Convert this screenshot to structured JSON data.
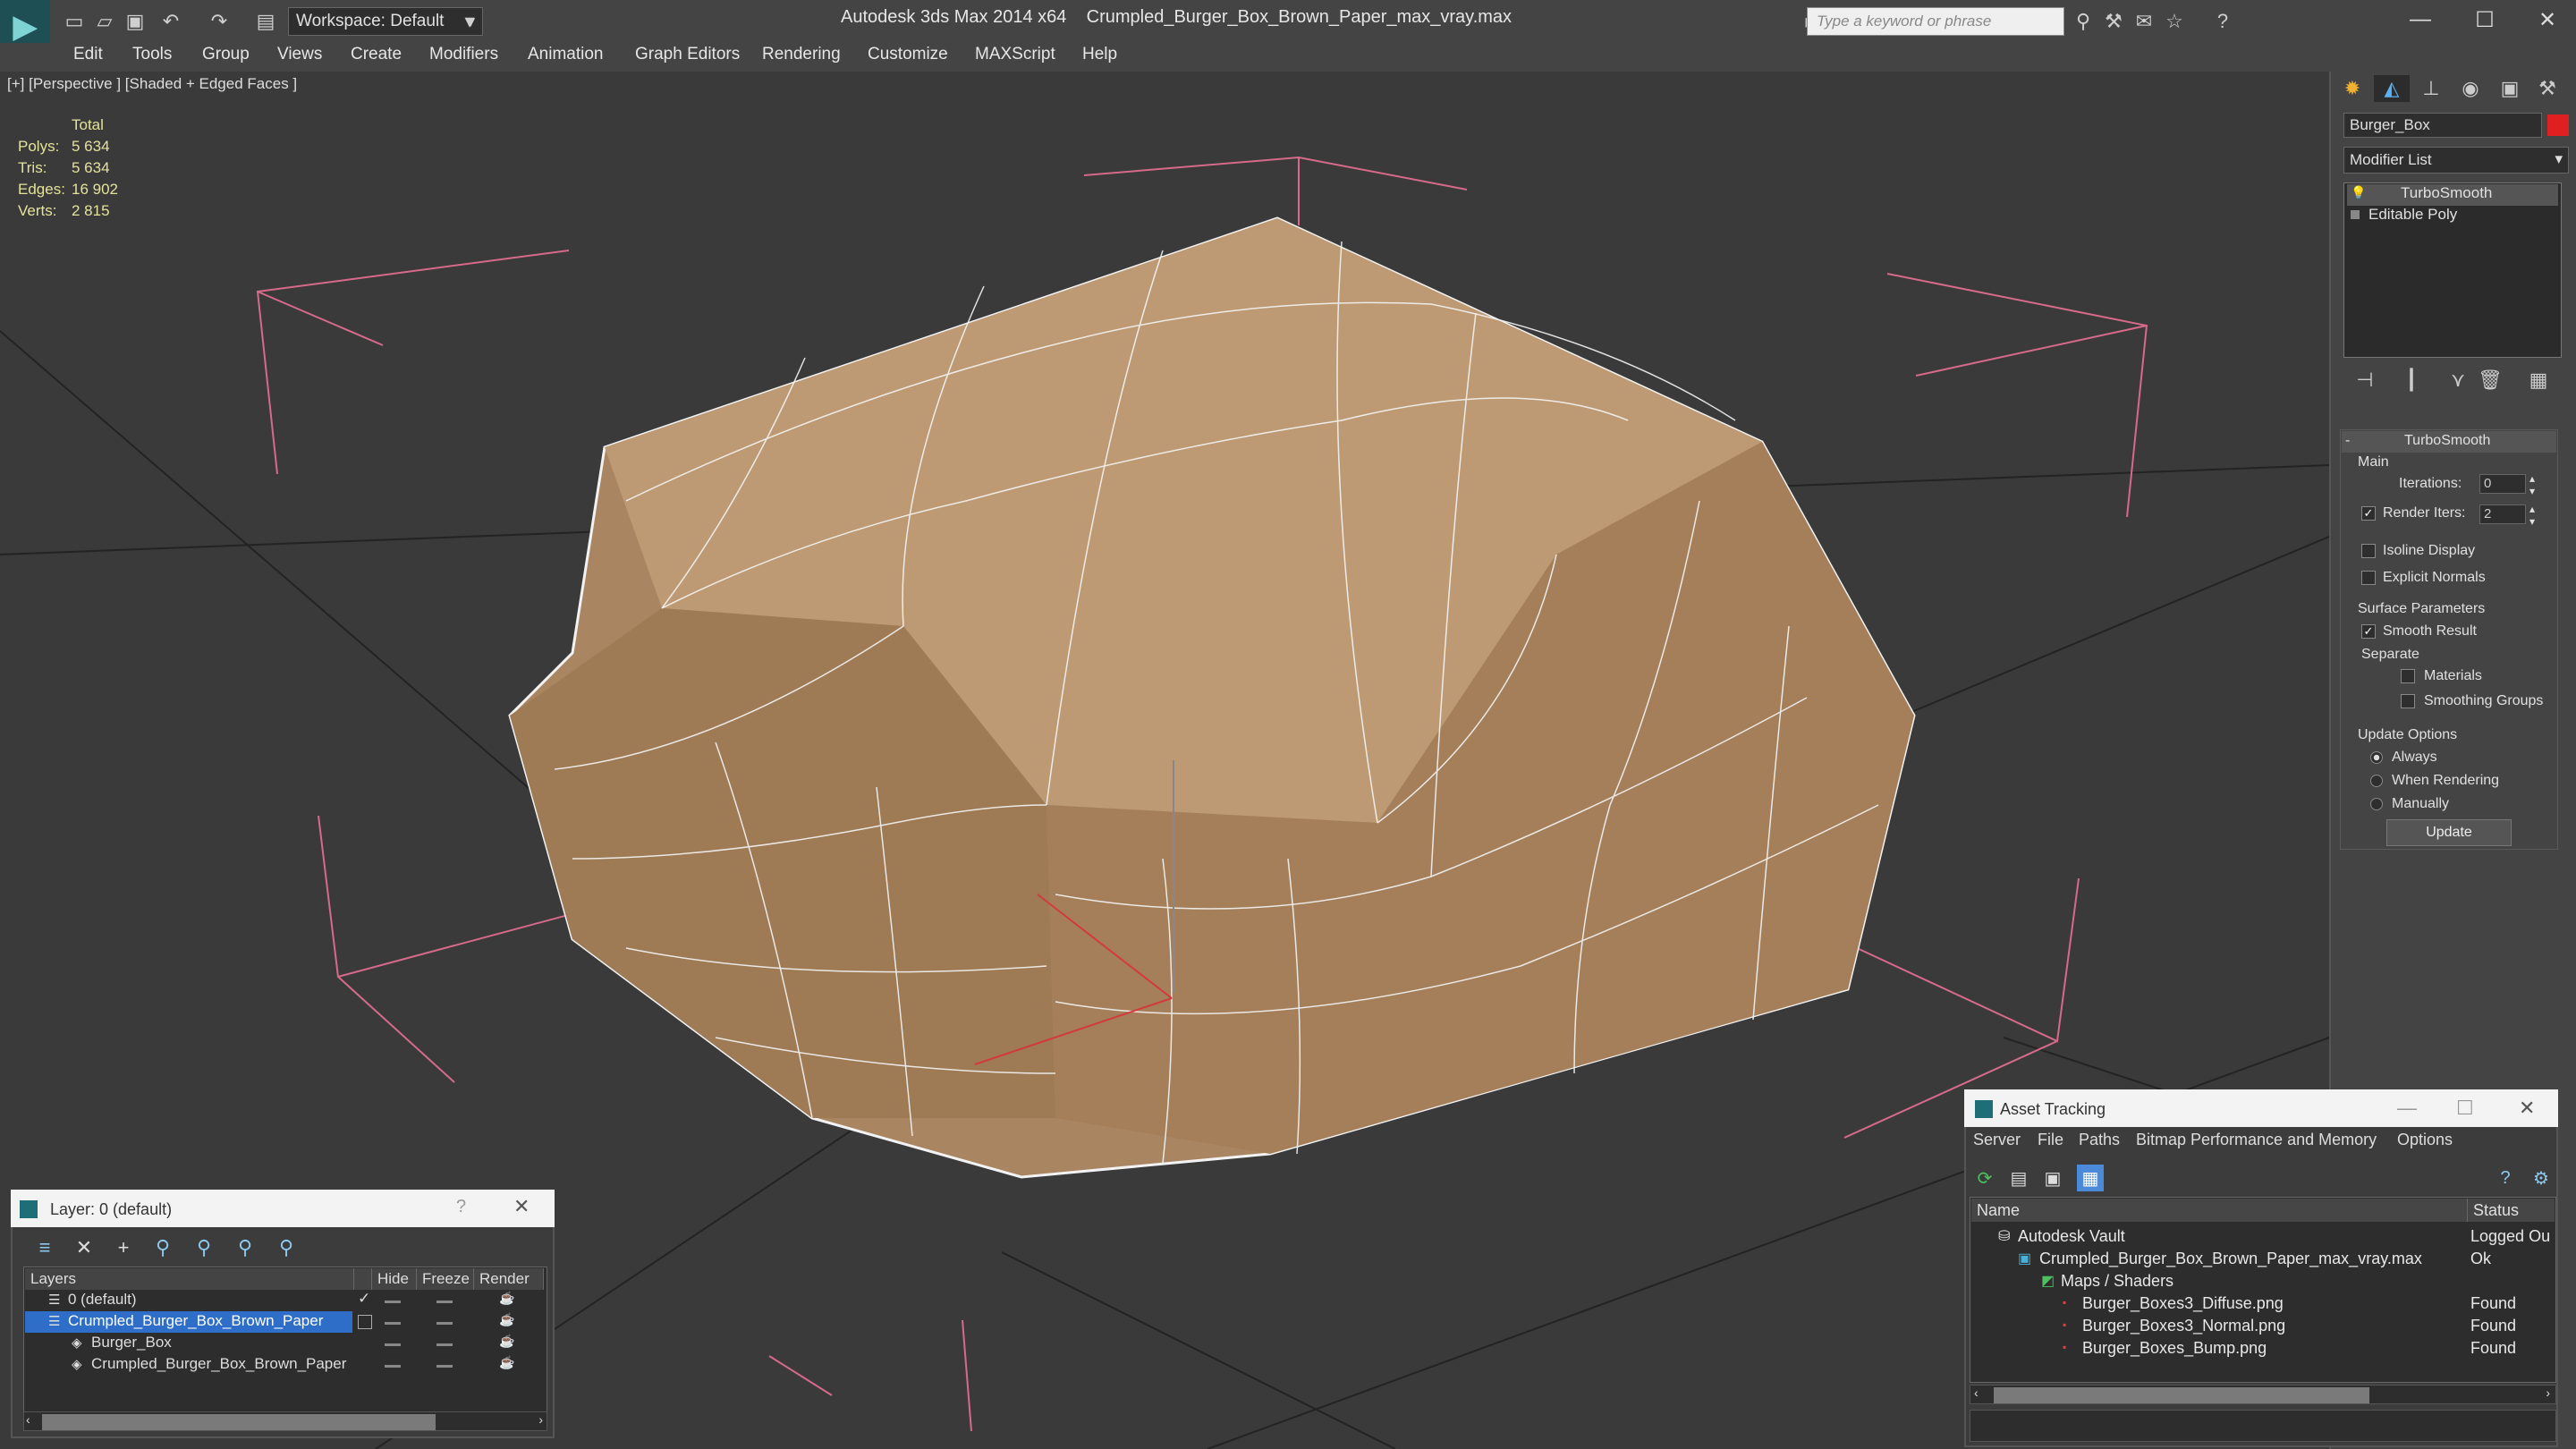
{
  "app": {
    "workspace": "Workspace: Default",
    "title": "Autodesk 3ds Max 2014 x64",
    "file": "Crumpled_Burger_Box_Brown_Paper_max_vray.max",
    "search_placeholder": "Type a keyword or phrase"
  },
  "menu": [
    "Edit",
    "Tools",
    "Group",
    "Views",
    "Create",
    "Modifiers",
    "Animation",
    "Graph Editors",
    "Rendering",
    "Customize",
    "MAXScript",
    "Help"
  ],
  "viewport": {
    "label": "[+] [Perspective ] [Shaded + Edged Faces ]",
    "stats": {
      "header": "Total",
      "rows": [
        {
          "label": "Polys:",
          "value": "5 634"
        },
        {
          "label": "Tris:",
          "value": "5 634"
        },
        {
          "label": "Edges:",
          "value": "16 902"
        },
        {
          "label": "Verts:",
          "value": "2 815"
        }
      ]
    }
  },
  "command_panel": {
    "object_name": "Burger_Box",
    "object_color": "#e02020",
    "modifier_list": "Modifier List",
    "stack": [
      "TurboSmooth",
      "Editable Poly"
    ],
    "rollout": {
      "title": "TurboSmooth",
      "main": "Main",
      "iterations_label": "Iterations:",
      "iterations_value": "0",
      "render_iters_label": "Render Iters:",
      "render_iters_value": "2",
      "isoline": "Isoline Display",
      "explicit": "Explicit Normals",
      "surface": "Surface Parameters",
      "smooth": "Smooth Result",
      "separate": "Separate",
      "materials": "Materials",
      "smoothing_groups": "Smoothing Groups",
      "update_options": "Update Options",
      "always": "Always",
      "when_rendering": "When Rendering",
      "manually": "Manually",
      "update": "Update"
    }
  },
  "layer_window": {
    "title": "Layer: 0 (default)",
    "help": "?",
    "close": "✕",
    "columns": [
      "Layers",
      "Hide",
      "Freeze",
      "Render"
    ],
    "rows": [
      {
        "name": "0 (default)",
        "selected": false
      },
      {
        "name": "Crumpled_Burger_Box_Brown_Paper",
        "selected": true
      },
      {
        "name": "Burger_Box",
        "selected": false
      },
      {
        "name": "Crumpled_Burger_Box_Brown_Paper",
        "selected": false
      }
    ]
  },
  "asset_window": {
    "title": "Asset Tracking",
    "menu": [
      "Server",
      "File",
      "Paths",
      "Bitmap Performance and Memory",
      "Options"
    ],
    "columns": [
      "Name",
      "Status"
    ],
    "rows": [
      {
        "name": "Autodesk Vault",
        "status": "Logged Ou"
      },
      {
        "name": "Crumpled_Burger_Box_Brown_Paper_max_vray.max",
        "status": "Ok"
      },
      {
        "name": "Maps / Shaders",
        "status": ""
      },
      {
        "name": "Burger_Boxes3_Diffuse.png",
        "status": "Found"
      },
      {
        "name": "Burger_Boxes3_Normal.png",
        "status": "Found"
      },
      {
        "name": "Burger_Boxes_Bump.png",
        "status": "Found"
      }
    ]
  }
}
